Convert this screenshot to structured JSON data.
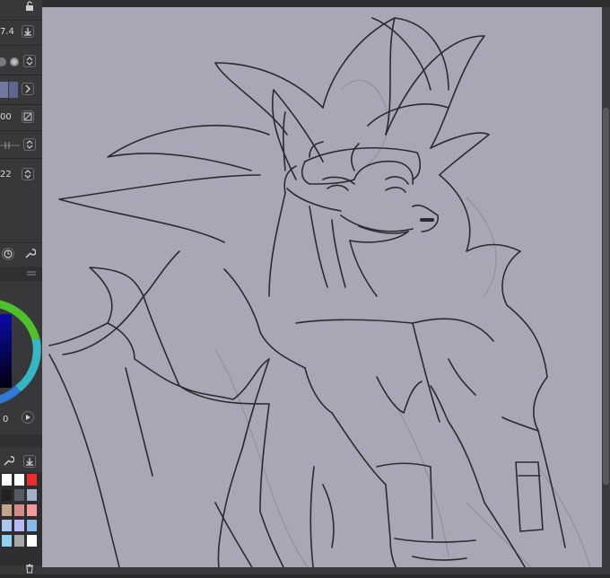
{
  "tool_panel": {
    "brush_size_value": "7.4",
    "opacity_value": "00",
    "stabilizer_value": "22",
    "color_value_readout": "0"
  },
  "icons": {
    "lock": "lock-icon",
    "download": "download-icon",
    "chevron_up_down": "updown-icon",
    "chevron_right": "chevron-right-icon",
    "no_entry": "no-entry-icon",
    "settings": "wrench-icon",
    "play": "play-icon",
    "trash": "trash-icon"
  },
  "palette": {
    "swatches": [
      "#ffffff",
      "#ffffff",
      "#e8302a",
      "#222222",
      "#555b62",
      "#9fb0c8",
      "#c7a48d",
      "#d48d86",
      "#f39a9a",
      "#a7c6f2",
      "#b8b8f6",
      "#88b8ea",
      "#8fd0f0",
      "#a8a8a8",
      "#ffffff"
    ]
  },
  "colors": {
    "canvas_bg": "#a9a7b5",
    "panel_bg": "#38383b",
    "line_color": "#2c2a30"
  }
}
